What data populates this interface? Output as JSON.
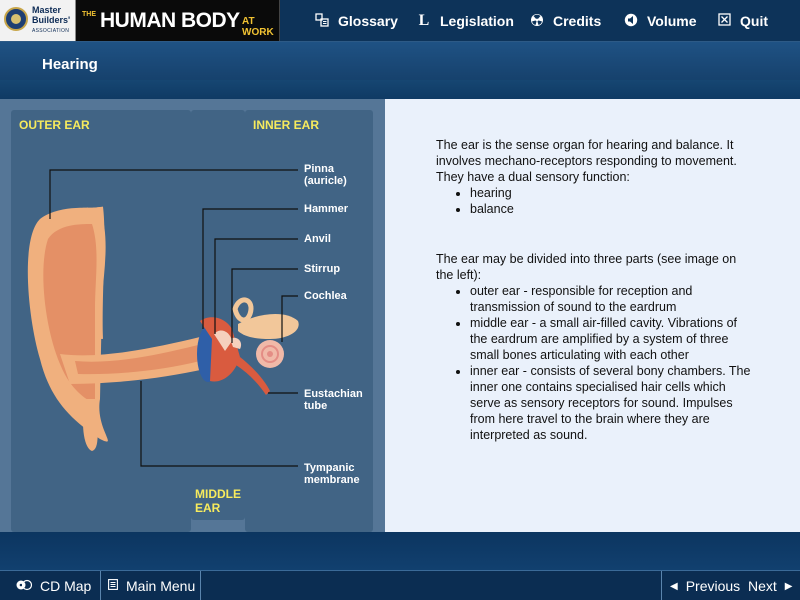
{
  "header": {
    "logo_line1": "Master",
    "logo_line2": "Builders'",
    "logo_assoc": "ASSOCIATION",
    "title_prefix": "THE",
    "title_main": "HUMAN BODY",
    "title_suffix": "AT WORK"
  },
  "nav": {
    "glossary": {
      "label": "Glossary",
      "icon": "glossary-icon"
    },
    "legislation": {
      "label": "Legislation",
      "icon": "legislation-icon"
    },
    "credits": {
      "label": "Credits",
      "icon": "credits-icon"
    },
    "volume": {
      "label": "Volume",
      "icon": "volume-icon"
    },
    "quit": {
      "label": "Quit",
      "icon": "quit-icon"
    }
  },
  "section": {
    "title": "Hearing"
  },
  "diagram": {
    "zones": {
      "outer": "OUTER EAR",
      "inner": "INNER EAR",
      "middle_line1": "MIDDLE",
      "middle_line2": "EAR"
    },
    "labels": {
      "pinna_1": "Pinna",
      "pinna_2": "(auricle)",
      "hammer": "Hammer",
      "anvil": "Anvil",
      "stirrup": "Stirrup",
      "cochlea": "Cochlea",
      "eustachian_1": "Eustachian",
      "eustachian_2": "tube",
      "tympanic_1": "Tympanic",
      "tympanic_2": "membrane"
    }
  },
  "content": {
    "para1": "The ear is the sense organ for hearing and balance. It involves mechano-receptors responding to movement. They have a dual sensory function:",
    "list1": [
      "hearing",
      "balance"
    ],
    "para2": "The ear may be divided into three parts (see image on the left):",
    "list2": [
      "outer ear - responsible for reception and transmission of sound to the eardrum",
      "middle ear - a small air-filled cavity. Vibrations of the eardrum are amplified by a system of three small bones articulating with each other",
      "inner ear - consists of several bony chambers. The inner one contains specialised hair cells which serve as sensory receptors for sound. Impulses from here travel to the brain where they are interpreted as sound."
    ]
  },
  "footer": {
    "cd_map": "CD Map",
    "main_menu": "Main Menu",
    "previous": "Previous",
    "next": "Next"
  },
  "colors": {
    "topbar": "#0d3359",
    "zone_label": "#f7eb5d",
    "text_panel": "#eaf1fb",
    "skin": "#f0b07e",
    "eardrum": "#2f5fa8"
  }
}
